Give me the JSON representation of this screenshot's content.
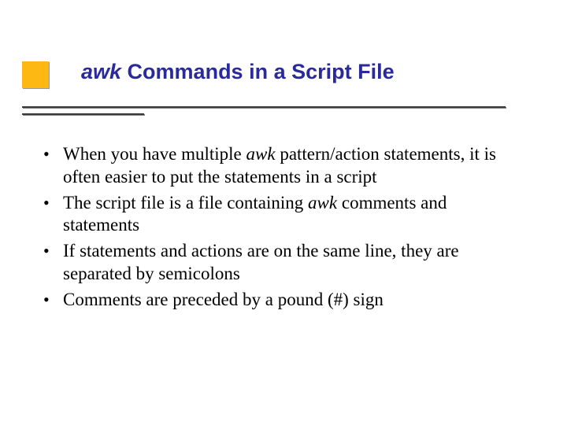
{
  "title": {
    "italic_prefix": "awk",
    "rest": " Commands in a Script File"
  },
  "bullets": [
    {
      "pre": "When you have multiple ",
      "italic": "awk",
      "post": " pattern/action statements, it is often easier to put the statements in a script"
    },
    {
      "pre": "The script file is a file containing ",
      "italic": "awk",
      "post": " comments and statements"
    },
    {
      "pre": "If statements and actions are on the same line, they are separated by semicolons",
      "italic": "",
      "post": ""
    },
    {
      "pre": "Comments are preceded by a pound (#) sign",
      "italic": "",
      "post": ""
    }
  ]
}
